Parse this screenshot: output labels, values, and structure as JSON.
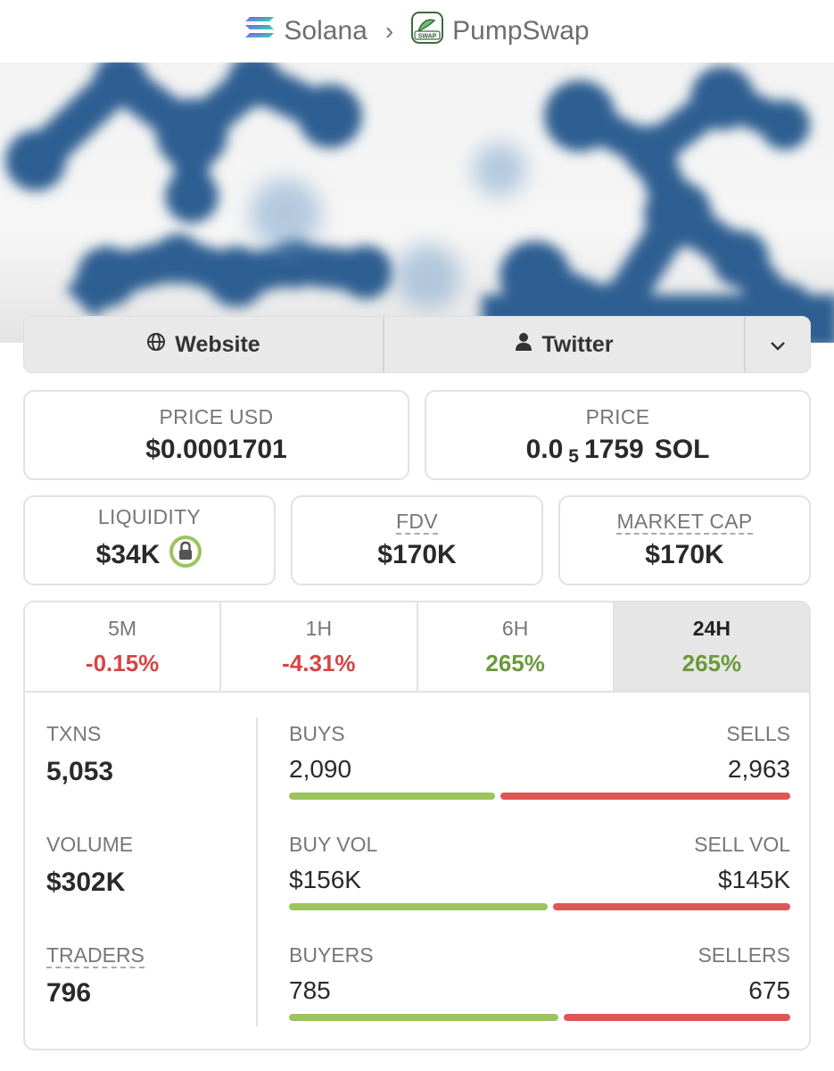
{
  "breadcrumb": {
    "chain": "Solana",
    "dex": "PumpSwap",
    "dex_badge": "SWAP"
  },
  "links": {
    "website": "Website",
    "twitter": "Twitter"
  },
  "price": {
    "usd_label": "PRICE USD",
    "usd_value": "$0.0001701",
    "native_label": "PRICE",
    "native_prefix": "0.0",
    "native_zeros": "5",
    "native_digits": "1759",
    "native_unit": "SOL"
  },
  "metrics": {
    "liquidity_label": "LIQUIDITY",
    "liquidity_value": "$34K",
    "fdv_label": "FDV",
    "fdv_value": "$170K",
    "mcap_label": "MARKET CAP",
    "mcap_value": "$170K"
  },
  "timeframes": [
    {
      "label": "5M",
      "change": "-0.15%",
      "direction": "down"
    },
    {
      "label": "1H",
      "change": "-4.31%",
      "direction": "down"
    },
    {
      "label": "6H",
      "change": "265%",
      "direction": "up"
    },
    {
      "label": "24H",
      "change": "265%",
      "direction": "up",
      "active": true
    }
  ],
  "stats": {
    "txns_label": "TXNS",
    "txns_value": "5,053",
    "volume_label": "VOLUME",
    "volume_value": "$302K",
    "traders_label": "TRADERS",
    "traders_value": "796",
    "buys_label": "BUYS",
    "buys_value": "2,090",
    "sells_label": "SELLS",
    "sells_value": "2,963",
    "buy_vol_label": "BUY VOL",
    "buy_vol_value": "$156K",
    "sell_vol_label": "SELL VOL",
    "sell_vol_value": "$145K",
    "buyers_label": "BUYERS",
    "buyers_value": "785",
    "sellers_label": "SELLERS",
    "sellers_value": "675"
  },
  "colors": {
    "positive": "#6a9a3a",
    "negative": "#d64545",
    "buy_bar": "#9cc45e",
    "sell_bar": "#df5656",
    "lock_ring": "#9cc45e"
  },
  "icons": {
    "chain": "solana-logo-icon",
    "dex": "pumpswap-logo-icon",
    "website": "globe-icon",
    "twitter": "user-icon",
    "more": "chevron-down-icon",
    "liquidity": "lock-icon"
  }
}
